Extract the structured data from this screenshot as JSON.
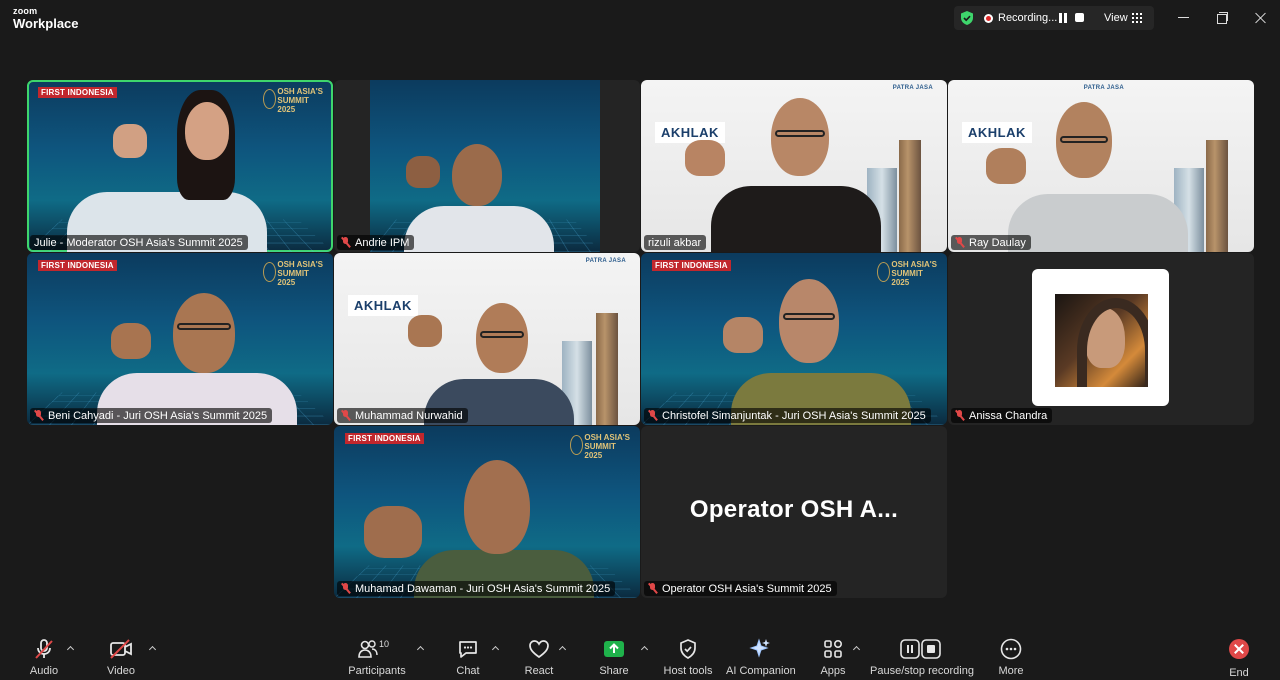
{
  "app": {
    "brand_top": "zoom",
    "brand_bottom": "Workplace"
  },
  "titlebar": {
    "recording_label": "Recording...",
    "view_label": "View",
    "shield_color": "#3ed66c",
    "record_color": "#e02828"
  },
  "gallery": {
    "active_speaker_color": "#3ed66c",
    "tiles": [
      {
        "name": "Julie - Moderator OSH Asia's Summit 2025",
        "muted": false,
        "background": "stage"
      },
      {
        "name": "Andrie IPM",
        "muted": true,
        "background": "stage"
      },
      {
        "name": "rizuli akbar",
        "muted": false,
        "background": "white"
      },
      {
        "name": "Ray Daulay",
        "muted": true,
        "background": "white"
      },
      {
        "name": "Beni Cahyadi - Juri OSH Asia's Summit 2025",
        "muted": true,
        "background": "stage"
      },
      {
        "name": "Muhammad Nurwahid",
        "muted": true,
        "background": "white"
      },
      {
        "name": "Christofel Simanjuntak - Juri OSH Asia's Summit 2025",
        "muted": true,
        "background": "stage"
      },
      {
        "name": "Anissa Chandra",
        "muted": true,
        "background": "avatar"
      },
      {
        "name": "Muhamad Dawaman - Juri OSH Asia's Summit 2025",
        "muted": true,
        "background": "stage"
      },
      {
        "name": "Operator OSH Asia's Summit 2025",
        "muted": true,
        "background": "name-only",
        "display_name": "Operator OSH A..."
      }
    ],
    "backdrop_logos": {
      "first": "FIRST INDONESIA",
      "osh": "OSH ASIA'S SUMMIT 2025",
      "akhlak": "AKHLAK",
      "patra": "PATRA JASA"
    }
  },
  "toolbar": {
    "audio": "Audio",
    "video": "Video",
    "participants": "Participants",
    "participants_count": "10",
    "chat": "Chat",
    "react": "React",
    "share": "Share",
    "host_tools": "Host tools",
    "ai_companion": "AI Companion",
    "apps": "Apps",
    "pause_stop_recording": "Pause/stop recording",
    "more": "More",
    "end": "End",
    "share_color": "#1fb24b",
    "end_color": "#e04848"
  }
}
